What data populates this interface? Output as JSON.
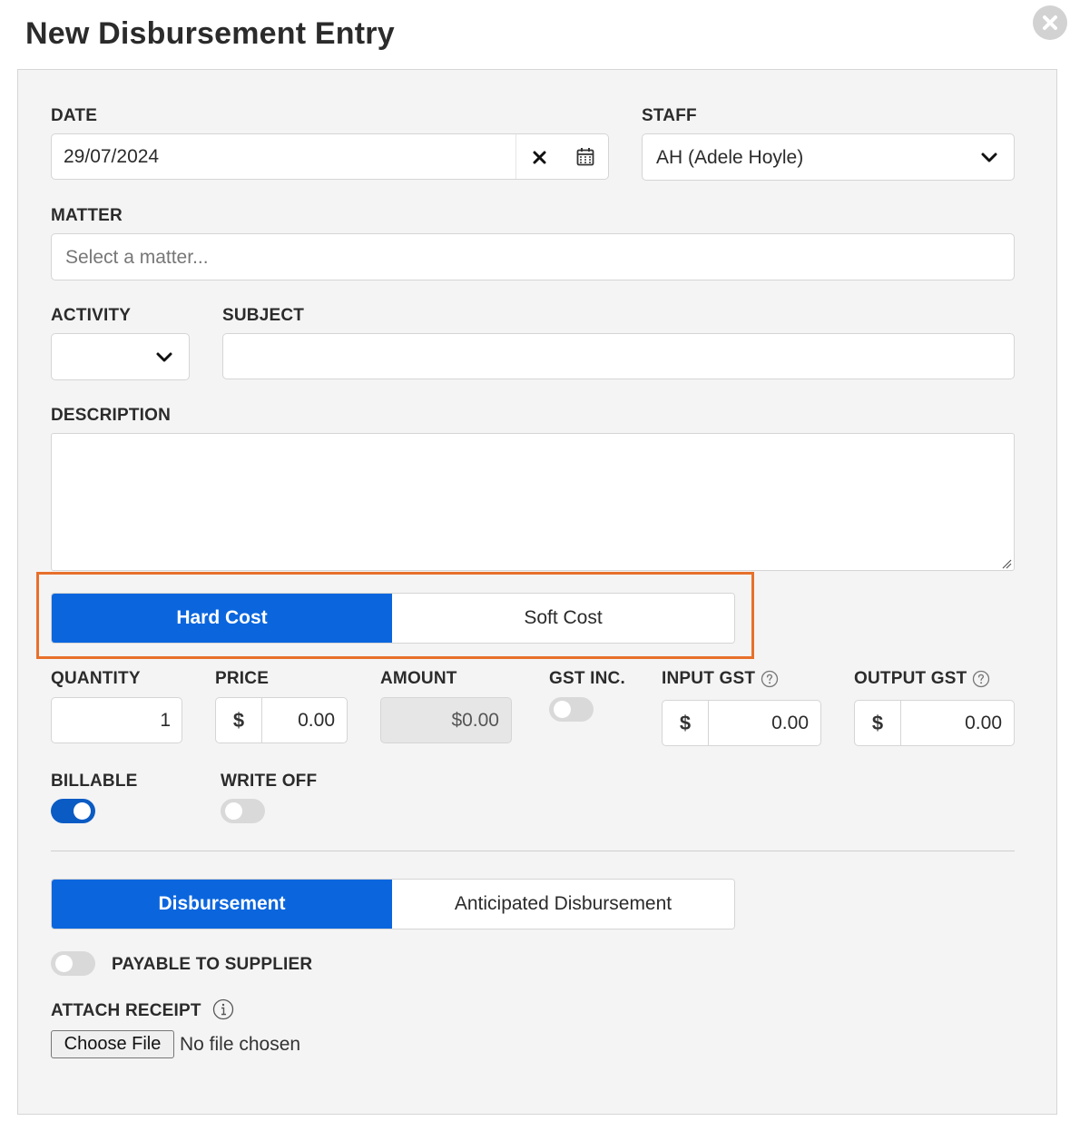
{
  "dialog": {
    "title": "New Disbursement Entry",
    "close_icon": "close-circle-icon"
  },
  "date": {
    "label": "DATE",
    "value": "29/07/2024",
    "clear_icon": "x-icon",
    "calendar_icon": "calendar-icon"
  },
  "staff": {
    "label": "STAFF",
    "value": "AH (Adele Hoyle)"
  },
  "matter": {
    "label": "MATTER",
    "placeholder": "Select a matter..."
  },
  "activity": {
    "label": "ACTIVITY",
    "value": ""
  },
  "subject": {
    "label": "SUBJECT",
    "value": ""
  },
  "description": {
    "label": "DESCRIPTION",
    "value": ""
  },
  "cost_type": {
    "options": [
      "Hard Cost",
      "Soft Cost"
    ],
    "selected": "Hard Cost"
  },
  "quantity": {
    "label": "QUANTITY",
    "value": "1"
  },
  "price": {
    "label": "PRICE",
    "currency": "$",
    "value": "0.00"
  },
  "amount": {
    "label": "AMOUNT",
    "value": "$0.00"
  },
  "gst_inc": {
    "label": "GST INC.",
    "on": false
  },
  "input_gst": {
    "label": "INPUT GST",
    "currency": "$",
    "value": "0.00"
  },
  "output_gst": {
    "label": "OUTPUT GST",
    "currency": "$",
    "value": "0.00"
  },
  "billable": {
    "label": "BILLABLE",
    "on": true
  },
  "write_off": {
    "label": "WRITE OFF",
    "on": false
  },
  "entry_type": {
    "options": [
      "Disbursement",
      "Anticipated Disbursement"
    ],
    "selected": "Disbursement"
  },
  "payable_to_supplier": {
    "label": "PAYABLE TO SUPPLIER",
    "on": false
  },
  "attach_receipt": {
    "label": "ATTACH RECEIPT",
    "button_label": "Choose File",
    "status": "No file chosen"
  },
  "colors": {
    "accent": "#0b66de",
    "highlight": "#e8702a",
    "toggle_on": "#0b5bc4",
    "toggle_off": "#d9d9d9"
  }
}
